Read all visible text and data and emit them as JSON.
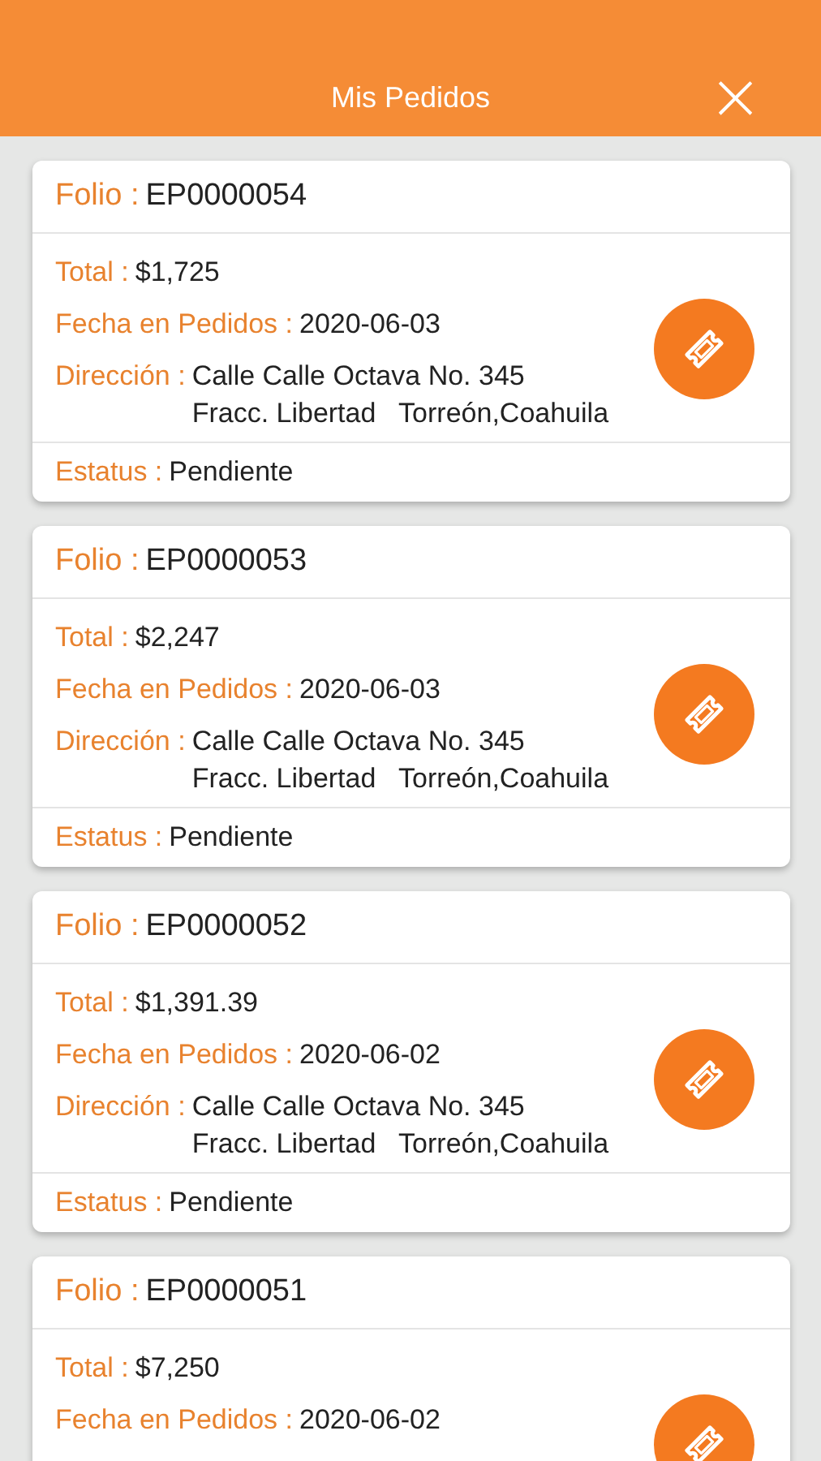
{
  "header": {
    "title": "Mis Pedidos",
    "close": "×"
  },
  "orders": [
    {
      "folio_label": "Folio :",
      "folio": "EP0000054",
      "fields": [
        {
          "label": "Total :",
          "lines": [
            "$1,725"
          ]
        },
        {
          "label": "Fecha en Pedidos :",
          "lines": [
            "2020-06-03"
          ]
        },
        {
          "label": "Dirección :",
          "lines": [
            "Calle Calle Octava No. 345",
            "Fracc. Libertad   Torreón,Coahuila"
          ]
        }
      ],
      "status": {
        "label": "Estatus :",
        "value": "Pendiente"
      }
    },
    {
      "folio_label": "Folio :",
      "folio": "EP0000053",
      "fields": [
        {
          "label": "Total :",
          "lines": [
            "$2,247"
          ]
        },
        {
          "label": "Fecha en Pedidos :",
          "lines": [
            "2020-06-03"
          ]
        },
        {
          "label": "Dirección :",
          "lines": [
            "Calle Calle Octava No. 345",
            "Fracc. Libertad   Torreón,Coahuila"
          ]
        }
      ],
      "status": {
        "label": "Estatus :",
        "value": "Pendiente"
      }
    },
    {
      "folio_label": "Folio :",
      "folio": "EP0000052",
      "fields": [
        {
          "label": "Total :",
          "lines": [
            "$1,391.39"
          ]
        },
        {
          "label": "Fecha en Pedidos :",
          "lines": [
            "2020-06-02"
          ]
        },
        {
          "label": "Dirección :",
          "lines": [
            "Calle Calle Octava No. 345",
            "Fracc. Libertad   Torreón,Coahuila"
          ]
        }
      ],
      "status": {
        "label": "Estatus :",
        "value": "Pendiente"
      }
    },
    {
      "folio_label": "Folio :",
      "folio": "EP0000051",
      "fields": [
        {
          "label": "Total :",
          "lines": [
            "$7,250"
          ]
        },
        {
          "label": "Fecha en Pedidos :",
          "lines": [
            "2020-06-02"
          ]
        }
      ]
    }
  ]
}
